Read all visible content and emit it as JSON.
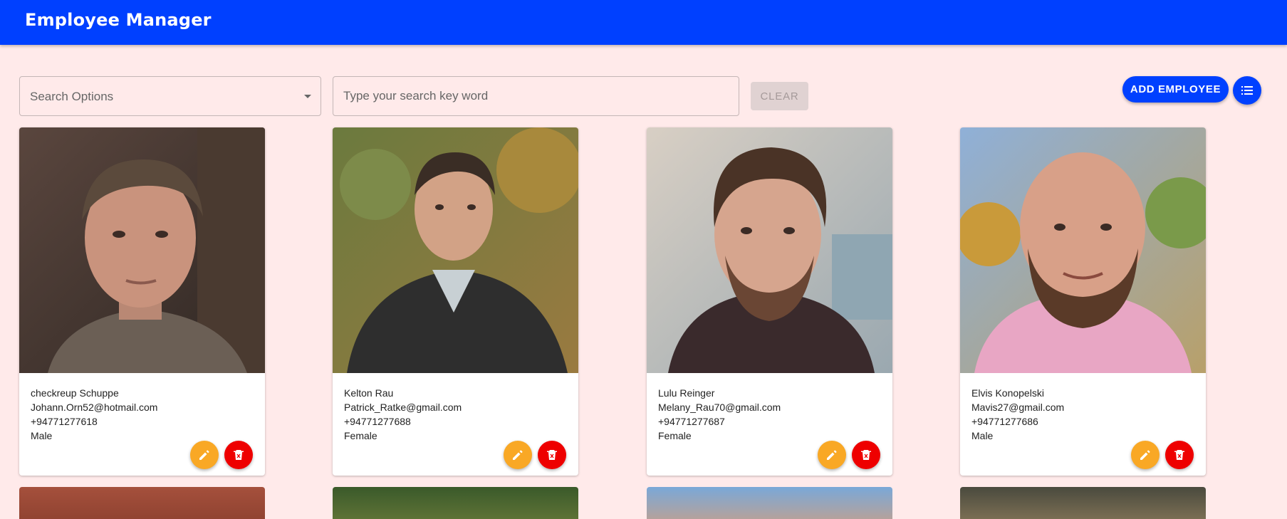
{
  "app": {
    "title": "Employee Manager"
  },
  "toolbar": {
    "search_options": {
      "selected": "Search Options"
    },
    "search_input": {
      "placeholder": "Type your search key word",
      "value": ""
    },
    "clear_label": "CLEAR",
    "add_label": "ADD EMPLOYEE",
    "view_toggle_icon": "list-icon"
  },
  "colors": {
    "primary": "#0040ff",
    "background": "#ffeaea",
    "edit": "#f9a825",
    "delete": "#ee0000"
  },
  "employees": [
    {
      "name": "checkreup Schuppe",
      "email": "Johann.Orn52@hotmail.com",
      "phone": "+94771277618",
      "gender": "Male"
    },
    {
      "name": "Kelton Rau",
      "email": "Patrick_Ratke@gmail.com",
      "phone": "+94771277688",
      "gender": "Female"
    },
    {
      "name": "Lulu Reinger",
      "email": "Melany_Rau70@gmail.com",
      "phone": "+94771277687",
      "gender": "Female"
    },
    {
      "name": "Elvis Konopelski",
      "email": "Mavis27@gmail.com",
      "phone": "+94771277686",
      "gender": "Male"
    }
  ],
  "card_actions": {
    "edit_icon": "pencil-icon",
    "delete_icon": "trash-icon"
  }
}
